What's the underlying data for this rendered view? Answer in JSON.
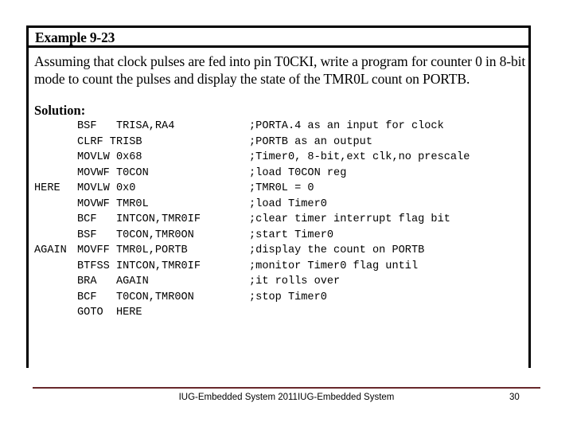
{
  "slide": {
    "example_box": {
      "title": "Example 9-23",
      "problem_statement": "Assuming that clock pulses are fed into pin T0CKI, write a program for counter 0 in 8-bit mode to count the pulses and display the state of the TMR0L count on PORTB.",
      "solution_heading": "Solution:",
      "code_lines": [
        {
          "label": "",
          "instruction": "BSF   TRISA,RA4",
          "comment": ";PORTA.4 as an input for clock"
        },
        {
          "label": "",
          "instruction": "CLRF TRISB",
          "comment": ";PORTB as an output"
        },
        {
          "label": "",
          "instruction": "MOVLW 0x68",
          "comment": ";Timer0, 8-bit,ext clk,no prescale"
        },
        {
          "label": "",
          "instruction": "MOVWF T0CON",
          "comment": ";load T0CON reg"
        },
        {
          "label": "HERE",
          "instruction": "MOVLW 0x0",
          "comment": ";TMR0L = 0"
        },
        {
          "label": "",
          "instruction": "MOVWF TMR0L",
          "comment": ";load Timer0"
        },
        {
          "label": "",
          "instruction": "BCF   INTCON,TMR0IF",
          "comment": ";clear timer interrupt flag bit"
        },
        {
          "label": "",
          "instruction": "BSF   T0CON,TMR0ON",
          "comment": ";start Timer0"
        },
        {
          "label": "AGAIN",
          "instruction": "MOVFF TMR0L,PORTB",
          "comment": ";display the count on PORTB"
        },
        {
          "label": "",
          "instruction": "BTFSS INTCON,TMR0IF",
          "comment": ";monitor Timer0 flag until"
        },
        {
          "label": "",
          "instruction": "BRA   AGAIN",
          "comment": ";it rolls over"
        },
        {
          "label": "",
          "instruction": "BCF   T0CON,TMR0ON",
          "comment": ";stop Timer0"
        },
        {
          "label": "",
          "instruction": "GOTO  HERE",
          "comment": ""
        }
      ]
    },
    "footer": {
      "text": "IUG-Embedded System 2011IUG-Embedded System",
      "page_number": "30",
      "rule_color": "#68282B"
    }
  }
}
